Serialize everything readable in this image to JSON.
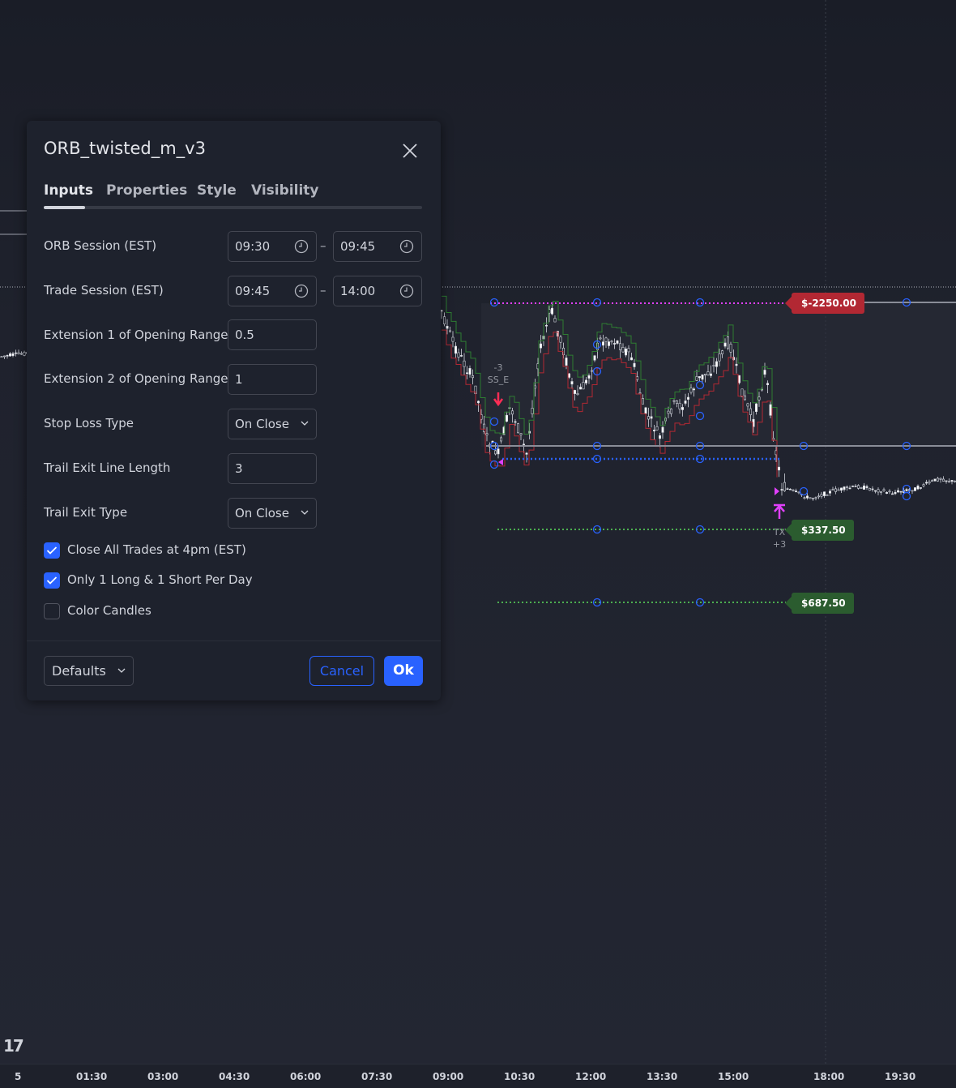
{
  "dialog": {
    "title": "ORB_twisted_m_v3",
    "tabs": [
      {
        "label": "Inputs",
        "active": true
      },
      {
        "label": "Properties",
        "active": false
      },
      {
        "label": "Style",
        "active": false
      },
      {
        "label": "Visibility",
        "active": false
      }
    ],
    "inputs": {
      "orb_session": {
        "label": "ORB Session (EST)",
        "start": "09:30",
        "end": "09:45"
      },
      "trade_session": {
        "label": "Trade Session (EST)",
        "start": "09:45",
        "end": "14:00"
      },
      "extension1": {
        "label": "Extension 1 of Opening Range",
        "value": "0.5"
      },
      "extension2": {
        "label": "Extension 2 of Opening Range",
        "value": "1"
      },
      "stop_loss_type": {
        "label": "Stop Loss Type",
        "value": "On Close"
      },
      "trail_exit_length": {
        "label": "Trail Exit Line Length",
        "value": "3"
      },
      "trail_exit_type": {
        "label": "Trail Exit Type",
        "value": "On Close"
      },
      "range_dash": "–",
      "checkboxes": [
        {
          "label": "Close All Trades at 4pm (EST)",
          "checked": true
        },
        {
          "label": "Only 1 Long & 1 Short Per Day",
          "checked": true
        },
        {
          "label": "Color Candles",
          "checked": false
        }
      ]
    },
    "footer": {
      "defaults_label": "Defaults",
      "cancel_label": "Cancel",
      "ok_label": "Ok"
    }
  },
  "chart": {
    "price_tags": [
      {
        "text": "$-2250.00",
        "color": "#b22833"
      },
      {
        "text": "$337.50",
        "color": "#2b5c2f"
      },
      {
        "text": "$687.50",
        "color": "#2b5c2f"
      }
    ],
    "short_entry_label": {
      "qty": "-3",
      "name": "SS_E"
    },
    "exit_label": {
      "name": "TX",
      "qty": "+3"
    },
    "time_axis": [
      "5",
      "01:30",
      "03:00",
      "04:30",
      "06:00",
      "07:30",
      "09:00",
      "10:30",
      "12:00",
      "13:30",
      "15:00",
      "18:00",
      "19:30"
    ],
    "colors": {
      "stop_line": "#e040fb",
      "entry_line": "#2962ff",
      "target_line": "#4caf50",
      "up_candle": "#ffffff",
      "red_step": "#b22833",
      "green_step": "#2e7d32"
    }
  }
}
